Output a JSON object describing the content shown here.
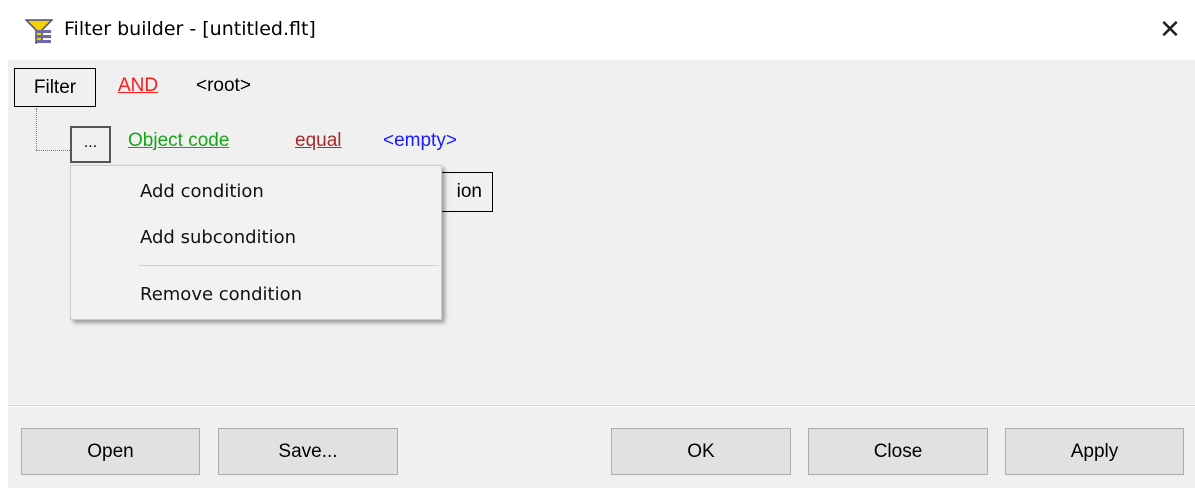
{
  "window": {
    "title": "Filter builder - [untitled.flt]",
    "icon": "filter-app-icon",
    "close_glyph": "✕"
  },
  "tree": {
    "root_label": "Filter",
    "logic_operator": "AND",
    "root_tag": "<root>",
    "condition": {
      "ellipsis": "...",
      "field": "Object code",
      "operator": "equal",
      "value": "<empty>"
    },
    "obscured_button_fragment": "ion"
  },
  "context_menu": {
    "items": [
      {
        "label": "Add condition"
      },
      {
        "label": "Add subcondition"
      },
      {
        "label": "Remove condition"
      }
    ]
  },
  "buttons": {
    "open": "Open",
    "save": "Save...",
    "ok": "OK",
    "close": "Close",
    "apply": "Apply"
  },
  "colors": {
    "logic_operator": "#ff1a1a",
    "field": "#1aa31a",
    "operator": "#a52a2a",
    "value": "#1a1aff",
    "dialog_bg": "#f0f0f0"
  }
}
